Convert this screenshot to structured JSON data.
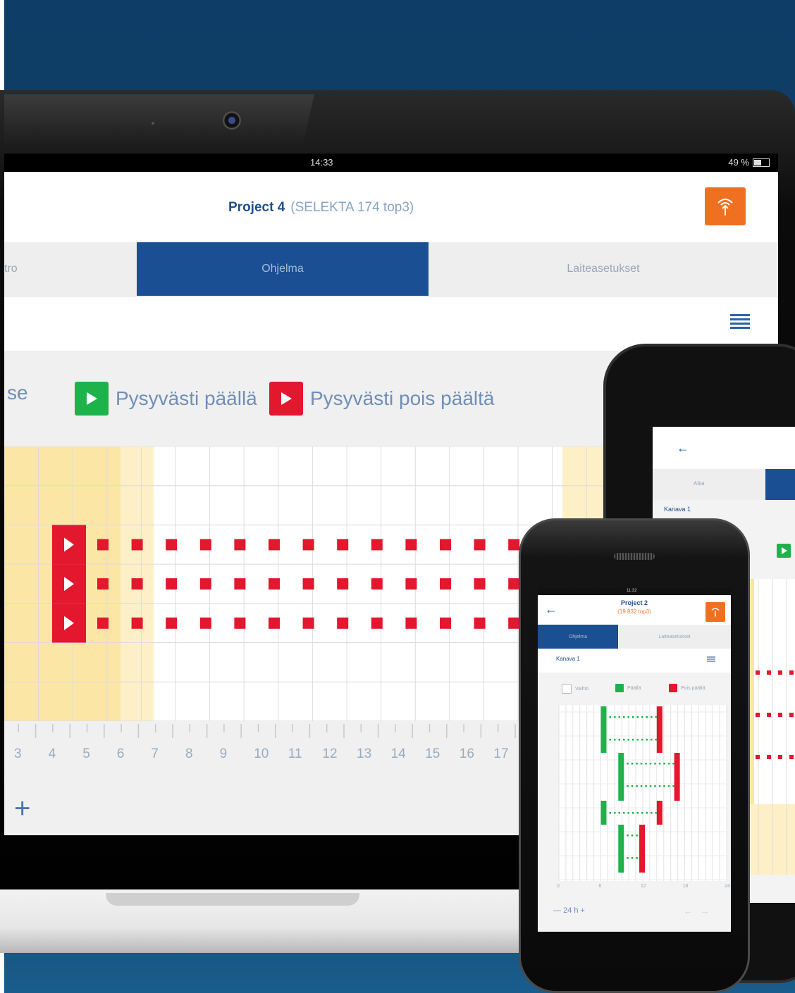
{
  "tablet": {
    "status": {
      "time": "14:33",
      "battery": "49 %"
    },
    "header": {
      "project": "Project 4",
      "device": "(SELEKTA 174 top3)",
      "sync_icon": "antenna-icon"
    },
    "tabs": [
      {
        "label": "tro",
        "active": false
      },
      {
        "label": "Ohjelma",
        "active": true
      },
      {
        "label": "Laiteasetukset",
        "active": false
      }
    ],
    "menu_icon": "list-icon",
    "legend": [
      {
        "label": "se",
        "color": null
      },
      {
        "label": "Pysyvästi päällä",
        "color": "#1db34a",
        "icon": "play-icon"
      },
      {
        "label": "Pysyvästi pois päältä",
        "color": "#e3172d",
        "icon": "play-icon"
      }
    ],
    "axis_ticks": [
      "3",
      "4",
      "5",
      "6",
      "7",
      "8",
      "9",
      "10",
      "11",
      "12",
      "13",
      "14",
      "15",
      "16",
      "17"
    ],
    "add_label": "+",
    "colors": {
      "accent": "#1a4f93",
      "sync": "#f07021",
      "on": "#1db34a",
      "off": "#e3172d",
      "highlight": "#fbe6a6"
    }
  },
  "phone_mid": {
    "back_icon": "arrow-left-icon",
    "tab_label": "Aika",
    "channel": "Kanava 1"
  },
  "phone_front": {
    "status": {
      "time": "11:32"
    },
    "header": {
      "title": "Project 2",
      "subtitle": "(19 832 top3)",
      "sync_icon": "antenna-icon"
    },
    "tabs": [
      {
        "label": "Ohjelma",
        "active": true
      },
      {
        "label": "Laiteasetukset",
        "active": false
      }
    ],
    "channel": "Kanava 1",
    "legend": [
      {
        "label": "Vaihto",
        "color": "#ffffff"
      },
      {
        "label": "Päällä",
        "color": "#1db34a"
      },
      {
        "label": "Pois päältä",
        "color": "#e3172d"
      }
    ],
    "axis_ticks": [
      "0",
      "6",
      "12",
      "18",
      "24"
    ],
    "zoom": "24 h",
    "zoom_out": "—",
    "zoom_in": "+",
    "nav_prev": "←",
    "nav_next": "→"
  }
}
